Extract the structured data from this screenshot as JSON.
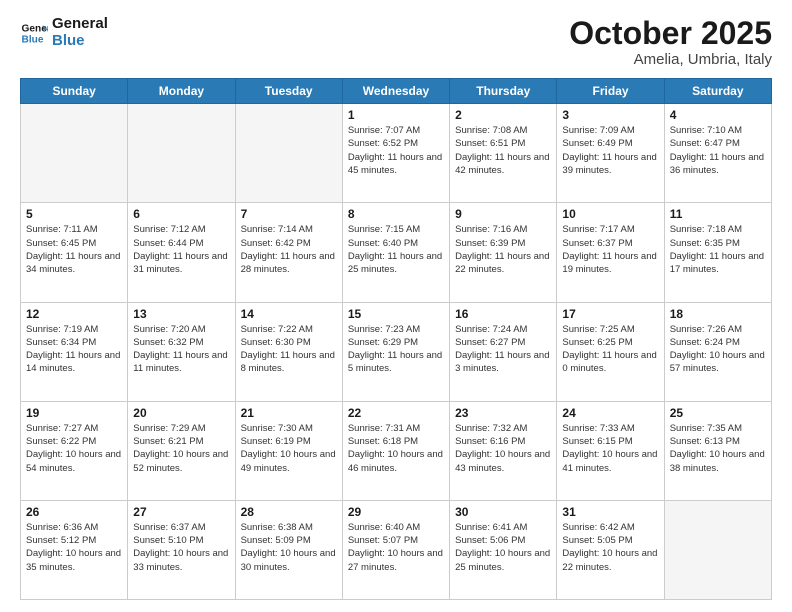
{
  "header": {
    "logo_general": "General",
    "logo_blue": "Blue",
    "month_year": "October 2025",
    "location": "Amelia, Umbria, Italy"
  },
  "days_of_week": [
    "Sunday",
    "Monday",
    "Tuesday",
    "Wednesday",
    "Thursday",
    "Friday",
    "Saturday"
  ],
  "weeks": [
    [
      {
        "num": "",
        "info": ""
      },
      {
        "num": "",
        "info": ""
      },
      {
        "num": "",
        "info": ""
      },
      {
        "num": "1",
        "info": "Sunrise: 7:07 AM\nSunset: 6:52 PM\nDaylight: 11 hours\nand 45 minutes."
      },
      {
        "num": "2",
        "info": "Sunrise: 7:08 AM\nSunset: 6:51 PM\nDaylight: 11 hours\nand 42 minutes."
      },
      {
        "num": "3",
        "info": "Sunrise: 7:09 AM\nSunset: 6:49 PM\nDaylight: 11 hours\nand 39 minutes."
      },
      {
        "num": "4",
        "info": "Sunrise: 7:10 AM\nSunset: 6:47 PM\nDaylight: 11 hours\nand 36 minutes."
      }
    ],
    [
      {
        "num": "5",
        "info": "Sunrise: 7:11 AM\nSunset: 6:45 PM\nDaylight: 11 hours\nand 34 minutes."
      },
      {
        "num": "6",
        "info": "Sunrise: 7:12 AM\nSunset: 6:44 PM\nDaylight: 11 hours\nand 31 minutes."
      },
      {
        "num": "7",
        "info": "Sunrise: 7:14 AM\nSunset: 6:42 PM\nDaylight: 11 hours\nand 28 minutes."
      },
      {
        "num": "8",
        "info": "Sunrise: 7:15 AM\nSunset: 6:40 PM\nDaylight: 11 hours\nand 25 minutes."
      },
      {
        "num": "9",
        "info": "Sunrise: 7:16 AM\nSunset: 6:39 PM\nDaylight: 11 hours\nand 22 minutes."
      },
      {
        "num": "10",
        "info": "Sunrise: 7:17 AM\nSunset: 6:37 PM\nDaylight: 11 hours\nand 19 minutes."
      },
      {
        "num": "11",
        "info": "Sunrise: 7:18 AM\nSunset: 6:35 PM\nDaylight: 11 hours\nand 17 minutes."
      }
    ],
    [
      {
        "num": "12",
        "info": "Sunrise: 7:19 AM\nSunset: 6:34 PM\nDaylight: 11 hours\nand 14 minutes."
      },
      {
        "num": "13",
        "info": "Sunrise: 7:20 AM\nSunset: 6:32 PM\nDaylight: 11 hours\nand 11 minutes."
      },
      {
        "num": "14",
        "info": "Sunrise: 7:22 AM\nSunset: 6:30 PM\nDaylight: 11 hours\nand 8 minutes."
      },
      {
        "num": "15",
        "info": "Sunrise: 7:23 AM\nSunset: 6:29 PM\nDaylight: 11 hours\nand 5 minutes."
      },
      {
        "num": "16",
        "info": "Sunrise: 7:24 AM\nSunset: 6:27 PM\nDaylight: 11 hours\nand 3 minutes."
      },
      {
        "num": "17",
        "info": "Sunrise: 7:25 AM\nSunset: 6:25 PM\nDaylight: 11 hours\nand 0 minutes."
      },
      {
        "num": "18",
        "info": "Sunrise: 7:26 AM\nSunset: 6:24 PM\nDaylight: 10 hours\nand 57 minutes."
      }
    ],
    [
      {
        "num": "19",
        "info": "Sunrise: 7:27 AM\nSunset: 6:22 PM\nDaylight: 10 hours\nand 54 minutes."
      },
      {
        "num": "20",
        "info": "Sunrise: 7:29 AM\nSunset: 6:21 PM\nDaylight: 10 hours\nand 52 minutes."
      },
      {
        "num": "21",
        "info": "Sunrise: 7:30 AM\nSunset: 6:19 PM\nDaylight: 10 hours\nand 49 minutes."
      },
      {
        "num": "22",
        "info": "Sunrise: 7:31 AM\nSunset: 6:18 PM\nDaylight: 10 hours\nand 46 minutes."
      },
      {
        "num": "23",
        "info": "Sunrise: 7:32 AM\nSunset: 6:16 PM\nDaylight: 10 hours\nand 43 minutes."
      },
      {
        "num": "24",
        "info": "Sunrise: 7:33 AM\nSunset: 6:15 PM\nDaylight: 10 hours\nand 41 minutes."
      },
      {
        "num": "25",
        "info": "Sunrise: 7:35 AM\nSunset: 6:13 PM\nDaylight: 10 hours\nand 38 minutes."
      }
    ],
    [
      {
        "num": "26",
        "info": "Sunrise: 6:36 AM\nSunset: 5:12 PM\nDaylight: 10 hours\nand 35 minutes."
      },
      {
        "num": "27",
        "info": "Sunrise: 6:37 AM\nSunset: 5:10 PM\nDaylight: 10 hours\nand 33 minutes."
      },
      {
        "num": "28",
        "info": "Sunrise: 6:38 AM\nSunset: 5:09 PM\nDaylight: 10 hours\nand 30 minutes."
      },
      {
        "num": "29",
        "info": "Sunrise: 6:40 AM\nSunset: 5:07 PM\nDaylight: 10 hours\nand 27 minutes."
      },
      {
        "num": "30",
        "info": "Sunrise: 6:41 AM\nSunset: 5:06 PM\nDaylight: 10 hours\nand 25 minutes."
      },
      {
        "num": "31",
        "info": "Sunrise: 6:42 AM\nSunset: 5:05 PM\nDaylight: 10 hours\nand 22 minutes."
      },
      {
        "num": "",
        "info": ""
      }
    ]
  ]
}
